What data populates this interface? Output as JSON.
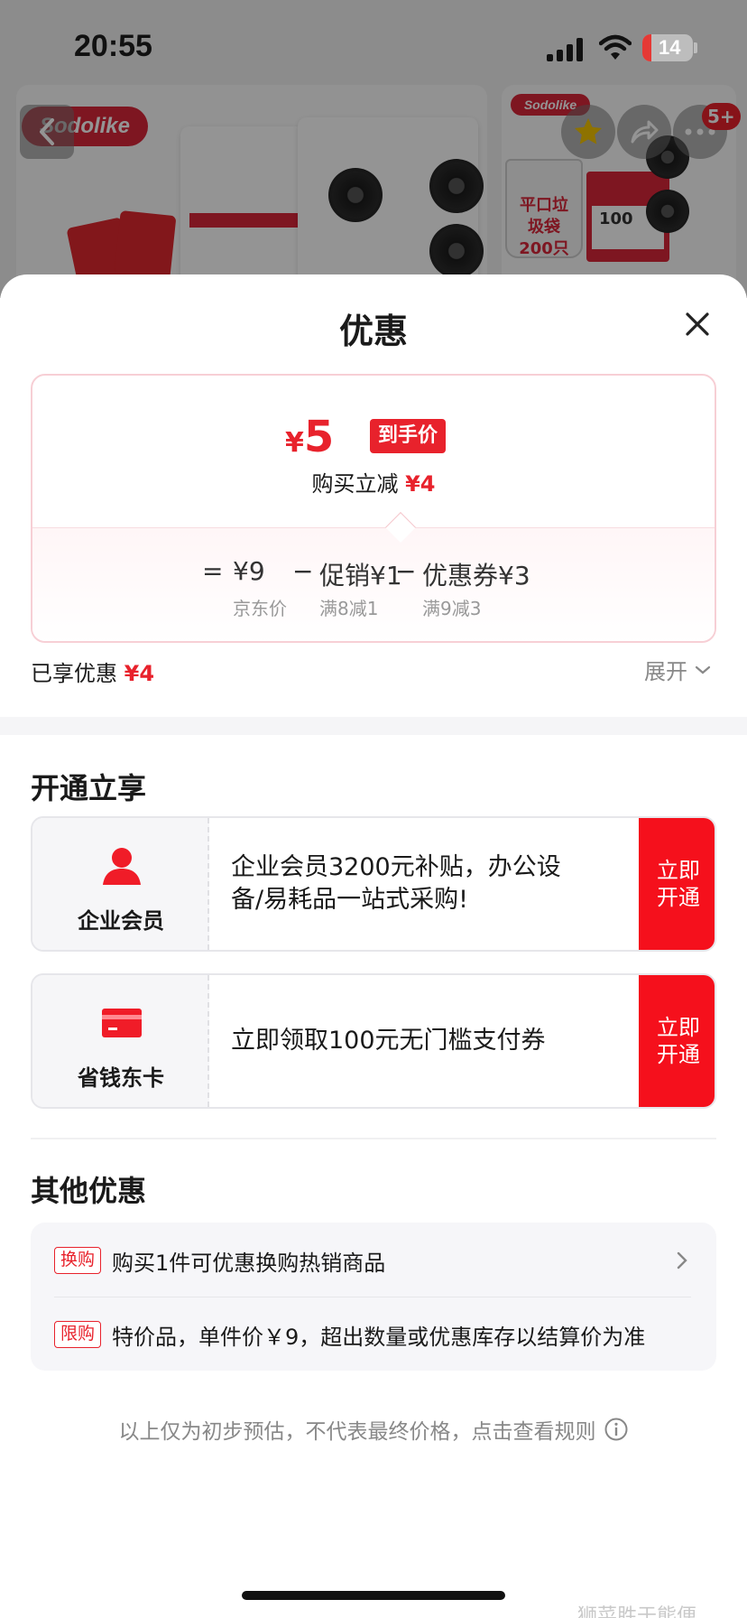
{
  "status_bar": {
    "time": "20:55",
    "battery": "14"
  },
  "background": {
    "brand": "Sodolike",
    "brand_small": "Sodolike",
    "bin_label": "平口垃圾袋\n200只",
    "box_label": "100",
    "badge_count": "5+"
  },
  "sheet": {
    "title": "优惠",
    "final_price": {
      "yen": "¥",
      "amount": "5",
      "tag": "到手价"
    },
    "instant_discount": {
      "label": "购买立减",
      "amount": "¥4"
    },
    "formula": {
      "equals": "=",
      "base_price": "¥9",
      "base_label": "京东价",
      "minus1": "−",
      "promo": "促销¥1",
      "promo_label": "满8减1",
      "minus2": "−",
      "coupon": "优惠券¥3",
      "coupon_label": "满9减3"
    },
    "enjoyed": {
      "label": "已享优惠",
      "amount": "¥4"
    },
    "expand_label": "展开",
    "open_section": {
      "title": "开通立享",
      "cards": [
        {
          "name": "企业会员",
          "icon": "person-icon",
          "desc": "企业会员3200元补贴，办公设备/易耗品一站式采购!",
          "button": "立即\n开通"
        },
        {
          "name": "省钱东卡",
          "icon": "card-icon",
          "desc": "立即领取100元无门槛支付券",
          "button": "立即\n开通"
        }
      ]
    },
    "other_section": {
      "title": "其他优惠",
      "items": [
        {
          "tag": "换购",
          "text": "购买1件可优惠换购热销商品"
        },
        {
          "tag": "限购",
          "text": "特价品，单件价￥9，超出数量或优惠库存以结算价为准"
        }
      ]
    },
    "footnote": "以上仅为初步预估，不代表最终价格，点击查看规则"
  },
  "watermark": "狮菜胜于熊便",
  "colors": {
    "accent_red": "#e8222c",
    "button_red": "#f5101c",
    "muted_text": "#888888"
  }
}
